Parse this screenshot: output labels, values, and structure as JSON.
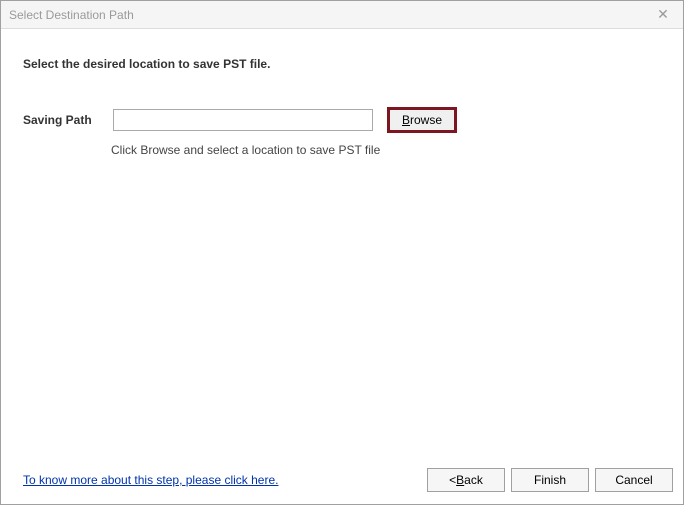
{
  "titlebar": {
    "title": "Select Destination Path"
  },
  "content": {
    "instruction": "Select the desired location to save PST file.",
    "path_label": "Saving Path",
    "path_value": "",
    "browse_label_u": "B",
    "browse_label_rest": "rowse",
    "hint": "Click Browse and select a location to save PST file"
  },
  "footer": {
    "link_text": "To know more about this step, please click here.",
    "back_prefix": "< ",
    "back_u": "B",
    "back_rest": "ack",
    "finish_label": "Finish",
    "cancel_label": "Cancel"
  }
}
